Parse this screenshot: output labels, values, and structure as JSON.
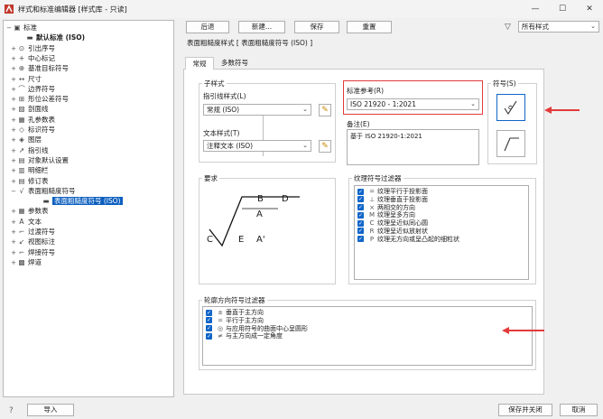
{
  "window": {
    "title": "样式和标准编辑器 [样式库 - 只读]",
    "minimize": "—",
    "maximize": "☐",
    "close": "✕"
  },
  "tree": {
    "root": "标准",
    "items": [
      {
        "label": "标准",
        "icon": "standard-icon",
        "glyph": "▣",
        "expand": "−"
      },
      {
        "label": "默认标准 (ISO)",
        "icon": "standard-doc-icon",
        "glyph": "▬",
        "expand": ""
      },
      {
        "label": "引出序号",
        "icon": "balloon-icon",
        "glyph": "⊙",
        "expand": "+"
      },
      {
        "label": "中心标记",
        "icon": "center-mark-icon",
        "glyph": "+",
        "expand": "+"
      },
      {
        "label": "基准目标符号",
        "icon": "datum-target-icon",
        "glyph": "⊕",
        "expand": "+"
      },
      {
        "label": "尺寸",
        "icon": "dimension-icon",
        "glyph": "↔",
        "expand": "+"
      },
      {
        "label": "边界符号",
        "icon": "edge-symbol-icon",
        "glyph": "⌒",
        "expand": "+"
      },
      {
        "label": "形位公差符号",
        "icon": "feature-control-icon",
        "glyph": "⊞",
        "expand": "+"
      },
      {
        "label": "剖面线",
        "icon": "hatch-icon",
        "glyph": "▨",
        "expand": "+"
      },
      {
        "label": "孔参数表",
        "icon": "hole-table-icon",
        "glyph": "▦",
        "expand": "+"
      },
      {
        "label": "标识符号",
        "icon": "identifier-icon",
        "glyph": "◇",
        "expand": "+"
      },
      {
        "label": "图层",
        "icon": "layer-icon",
        "glyph": "◈",
        "expand": "+"
      },
      {
        "label": "指引线",
        "icon": "leader-icon",
        "glyph": "↗",
        "expand": "+"
      },
      {
        "label": "对象默认设置",
        "icon": "object-defaults-icon",
        "glyph": "▤",
        "expand": "+"
      },
      {
        "label": "明细栏",
        "icon": "parts-list-icon",
        "glyph": "▥",
        "expand": "+"
      },
      {
        "label": "修订表",
        "icon": "revision-table-icon",
        "glyph": "▤",
        "expand": "+"
      },
      {
        "label": "表面粗糙度符号",
        "icon": "surface-texture-icon",
        "glyph": "√",
        "expand": "−"
      },
      {
        "label": "表面粗糙度符号 (ISO)",
        "icon": "surface-texture-item-icon",
        "glyph": "▬",
        "expand": ""
      },
      {
        "label": "参数表",
        "icon": "parameter-table-icon",
        "glyph": "▦",
        "expand": "+"
      },
      {
        "label": "文本",
        "icon": "text-icon",
        "glyph": "A",
        "expand": "+"
      },
      {
        "label": "过渡符号",
        "icon": "weld-bead-icon",
        "glyph": "⌐",
        "expand": "+"
      },
      {
        "label": "视图标注",
        "icon": "view-annotation-icon",
        "glyph": "↙",
        "expand": "+"
      },
      {
        "label": "焊接符号",
        "icon": "weld-symbol-icon",
        "glyph": "⌐",
        "expand": "+"
      },
      {
        "label": "焊道",
        "icon": "weld-caterpillar-icon",
        "glyph": "▩",
        "expand": "+"
      }
    ]
  },
  "toolbar": {
    "back": "后退",
    "new": "新建...",
    "save": "保存",
    "reset": "重置",
    "filter_value": "所有样式"
  },
  "header": {
    "breadcrumb": "表面粗糙度样式 [ 表面粗糙度符号 (ISO) ]"
  },
  "tabs": [
    {
      "label": "常规"
    },
    {
      "label": "多数符号"
    }
  ],
  "substyle": {
    "group_label": "子样式",
    "leader_label": "指引线样式(L)",
    "leader_value": "常规 (ISO)",
    "text_label": "文本样式(T)",
    "text_value": "注释文本 (ISO)"
  },
  "standard_ref": {
    "label": "标准参考(R)",
    "value": "ISO 21920 - 1:2021",
    "note_label": "备注(E)",
    "note_value": "基于 ISO 21920-1:2021"
  },
  "symbol": {
    "label": "符号(S)"
  },
  "requirements": {
    "label": "要求",
    "letters": [
      "B",
      "D",
      "A",
      "C",
      "E",
      "A'"
    ]
  },
  "texture_filter": {
    "label": "纹理符号过滤器",
    "rows": [
      {
        "sym": "=",
        "text": "纹理平行于投影面"
      },
      {
        "sym": "⊥",
        "text": "纹理垂直于投影面"
      },
      {
        "sym": "×",
        "text": "两相交的方向"
      },
      {
        "sym": "M",
        "text": "纹理呈多方向"
      },
      {
        "sym": "C",
        "text": "纹理呈近似同心圆"
      },
      {
        "sym": "R",
        "text": "纹理呈近似放射状"
      },
      {
        "sym": "P",
        "text": "纹理无方向或呈凸起的细粒状"
      }
    ]
  },
  "contour_filter": {
    "label": "轮廓方向符号过滤器",
    "rows": [
      {
        "sym": "±",
        "text": "垂直于主方向"
      },
      {
        "sym": "=",
        "text": "平行于主方向"
      },
      {
        "sym": "◎",
        "text": "与应用符号的曲面中心呈圆形"
      },
      {
        "sym": "≠",
        "text": "与主方向成一定角度"
      }
    ]
  },
  "footer": {
    "import": "导入",
    "save_close": "保存并关闭",
    "cancel": "取消"
  },
  "colors": {
    "accent": "#1065c8",
    "selection": "#0c5fbf",
    "highlight_border": "#e23b3b",
    "arrow": "#e23b3b"
  }
}
